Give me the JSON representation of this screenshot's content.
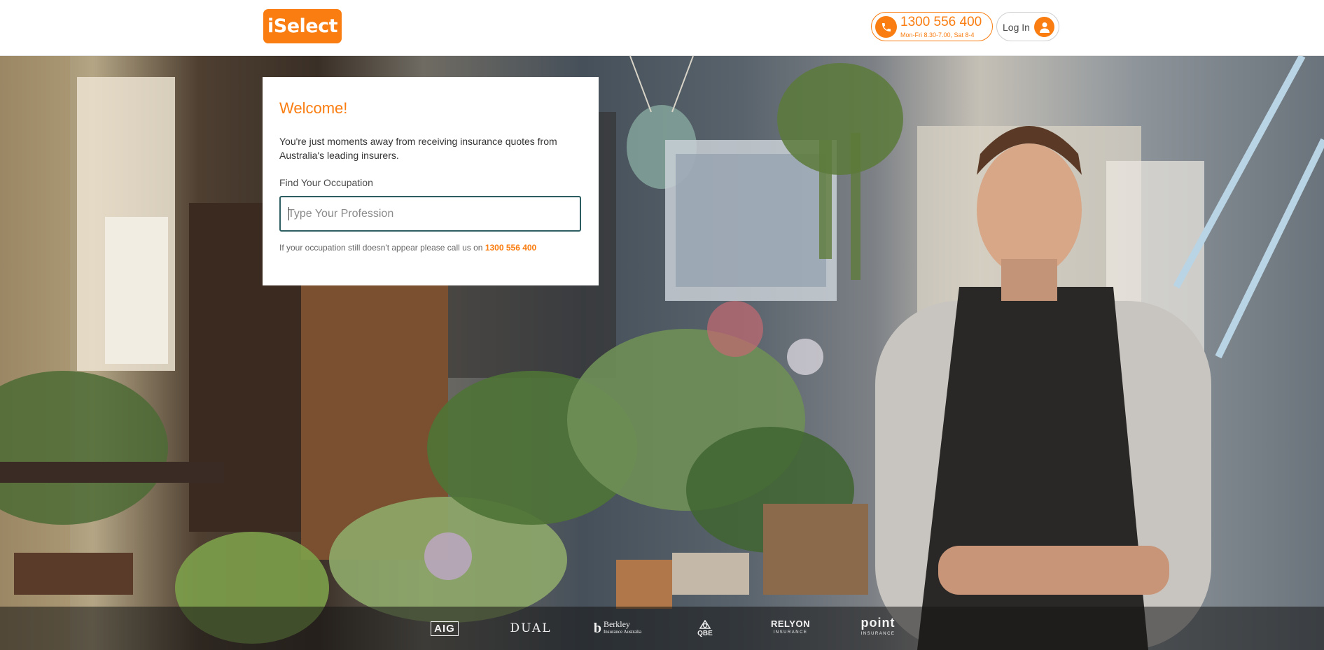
{
  "header": {
    "logo_text": "iSelect",
    "phone_number": "1300 556 400",
    "phone_hours": "Mon-Fri 8.30-7.00, Sat 8-4",
    "login_label": "Log In"
  },
  "card": {
    "title": "Welcome!",
    "intro": "You're just moments away from receiving insurance quotes from Australia's leading insurers.",
    "field_label": "Find Your Occupation",
    "input_placeholder": "Type Your Profession",
    "input_value": "",
    "help_text": "If your occupation still doesn't appear please call us on",
    "help_phone": "1300 556 400"
  },
  "insurers": {
    "aig": "AIG",
    "dual": "DUAL",
    "berkley": "Berkley",
    "berkley_sub": "Insurance Australia",
    "qbe": "QBE",
    "relyon": "RELYON",
    "relyon_sub": "INSURANCE",
    "point": "point",
    "point_sub": "INSURANCE"
  },
  "colors": {
    "brand_orange": "#f97d10",
    "input_border": "#2c5e62"
  },
  "icons": {
    "phone": "phone-icon",
    "user": "user-icon"
  }
}
